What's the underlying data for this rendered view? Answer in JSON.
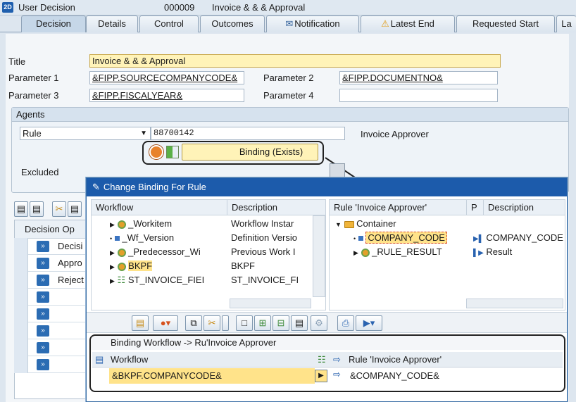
{
  "header": {
    "icon": "2D",
    "title": "User Decision",
    "id": "000009",
    "subtitle": "Invoice & & & Approval"
  },
  "tabs": [
    {
      "label": "Decision"
    },
    {
      "label": "Details"
    },
    {
      "label": "Control"
    },
    {
      "label": "Outcomes"
    },
    {
      "label": "Notification"
    },
    {
      "label": "Latest End"
    },
    {
      "label": "Requested Start"
    },
    {
      "label": "La"
    }
  ],
  "form": {
    "title_label": "Title",
    "title_value": "Invoice & & & Approval",
    "p1_label": "Parameter 1",
    "p1_value": "&FIPP.SOURCECOMPANYCODE&",
    "p2_label": "Parameter 2",
    "p2_value": "&FIPP.DOCUMENTNO&",
    "p3_label": "Parameter 3",
    "p3_value": "&FIPP.FISCALYEAR&",
    "p4_label": "Parameter 4",
    "p4_value": ""
  },
  "agents": {
    "group_title": "Agents",
    "type_value": "Rule",
    "rule_number": "88700142",
    "rule_desc": "Invoice Approver",
    "binding_label": "Binding (Exists)",
    "excluded_label": "Excluded"
  },
  "decision_table": {
    "header": "Decision Op",
    "col": "Decisi",
    "rows": [
      "Appro",
      "Reject",
      "",
      "",
      "",
      "",
      ""
    ]
  },
  "popup": {
    "title": "Change Binding For Rule",
    "left": {
      "col_workflow": "Workflow",
      "col_desc": "Description",
      "rows": [
        {
          "name": "_Workitem",
          "desc": "Workflow Instar"
        },
        {
          "name": "_Wf_Version",
          "desc": "Definition Versio"
        },
        {
          "name": "_Predecessor_Wi",
          "desc": "Previous Work I"
        },
        {
          "name": "BKPF",
          "desc": "BKPF"
        },
        {
          "name": "ST_INVOICE_FIEI",
          "desc": "ST_INVOICE_FI"
        }
      ]
    },
    "right": {
      "col_rule": "Rule 'Invoice Approver'",
      "col_p": "P",
      "col_desc": "Description",
      "container": "Container",
      "rows": [
        {
          "name": "COMPANY_CODE",
          "desc": "COMPANY_CODE"
        },
        {
          "name": "_RULE_RESULT",
          "desc": "Result"
        }
      ]
    },
    "binding": {
      "title": "Binding Workflow  -> Ru'Invoice Approver",
      "col_workflow": "Workflow",
      "col_rule": "Rule 'Invoice Approver'",
      "left_value": "&BKPF.COMPANYCODE&",
      "right_value": "&COMPANY_CODE&"
    }
  }
}
